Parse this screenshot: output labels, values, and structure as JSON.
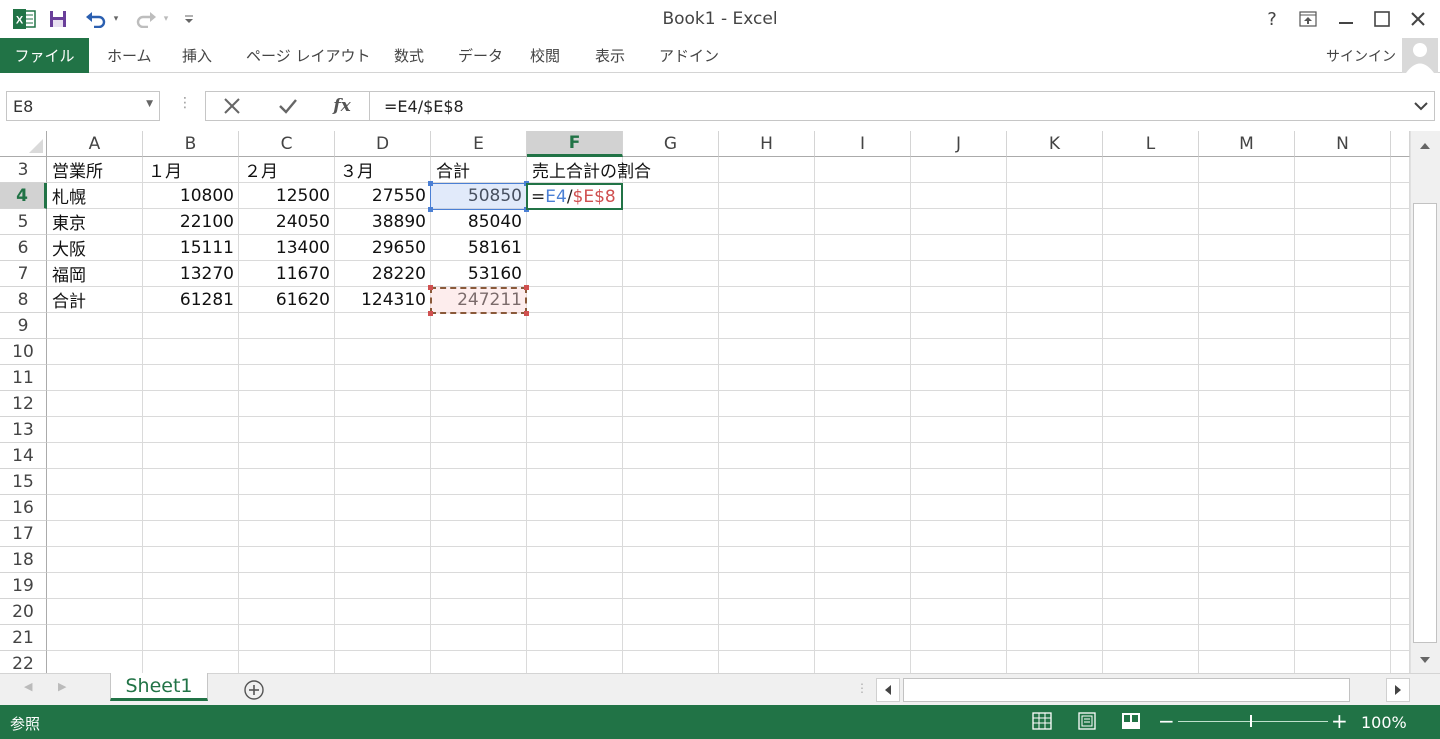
{
  "window": {
    "title": "Book1 - Excel",
    "help": "?"
  },
  "ribbon": {
    "file_tab": "ファイル",
    "tabs": [
      "ホーム",
      "挿入",
      "ページ レイアウト",
      "数式",
      "データ",
      "校閲",
      "表示",
      "アドイン"
    ],
    "signin": "サインイン"
  },
  "formula_bar": {
    "name_box": "E8",
    "formula": "=E4/$E$8"
  },
  "sheet": {
    "columns": [
      "A",
      "B",
      "C",
      "D",
      "E",
      "F",
      "G",
      "H",
      "I",
      "J",
      "K",
      "L",
      "M",
      "N"
    ],
    "selected_column": "F",
    "selected_row": "4",
    "rows": [
      {
        "num": "3",
        "cells": [
          "営業所",
          "１月",
          "２月",
          "３月",
          "合計",
          "売上合計の割合"
        ]
      },
      {
        "num": "4",
        "cells": [
          "札幌",
          "10800",
          "12500",
          "27550",
          "50850",
          ""
        ]
      },
      {
        "num": "5",
        "cells": [
          "東京",
          "22100",
          "24050",
          "38890",
          "85040",
          ""
        ]
      },
      {
        "num": "6",
        "cells": [
          "大阪",
          "15111",
          "13400",
          "29650",
          "58161",
          ""
        ]
      },
      {
        "num": "7",
        "cells": [
          "福岡",
          "13270",
          "11670",
          "28220",
          "53160",
          ""
        ]
      },
      {
        "num": "8",
        "cells": [
          "合計",
          "61281",
          "61620",
          "124310",
          "247211",
          ""
        ]
      },
      {
        "num": "9",
        "cells": []
      },
      {
        "num": "10",
        "cells": []
      },
      {
        "num": "11",
        "cells": []
      },
      {
        "num": "12",
        "cells": []
      },
      {
        "num": "13",
        "cells": []
      },
      {
        "num": "14",
        "cells": []
      },
      {
        "num": "15",
        "cells": []
      },
      {
        "num": "16",
        "cells": []
      },
      {
        "num": "17",
        "cells": []
      },
      {
        "num": "18",
        "cells": []
      },
      {
        "num": "19",
        "cells": []
      },
      {
        "num": "20",
        "cells": []
      },
      {
        "num": "21",
        "cells": []
      },
      {
        "num": "22",
        "cells": []
      }
    ],
    "editing": {
      "eq": "=",
      "ref1": "E4",
      "op": "/",
      "ref2": "$E$8"
    }
  },
  "sheet_tabs": {
    "active": "Sheet1"
  },
  "status": {
    "mode": "参照",
    "zoom": "100%"
  },
  "colors": {
    "brand": "#217346",
    "ref1": "#4a7fd4",
    "ref2": "#d05050"
  }
}
